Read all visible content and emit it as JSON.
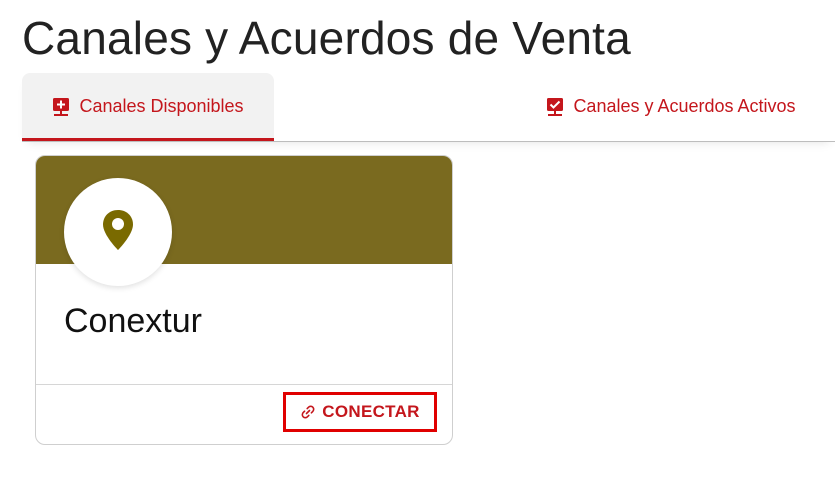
{
  "page": {
    "title": "Canales y Acuerdos de Venta"
  },
  "tabs": [
    {
      "label": "Canales Disponibles",
      "icon": "add-channel-icon",
      "selected": true
    },
    {
      "label": "Canales y Acuerdos Activos",
      "icon": "active-channel-check-icon",
      "selected": false
    }
  ],
  "card": {
    "name": "Conextur",
    "icon": "map-pin-icon",
    "banner_color": "#7a6a1f",
    "connect_label": "CONECTAR",
    "connect_icon": "link-icon"
  },
  "colors": {
    "accent": "#c4161c",
    "highlight_border": "#e00000"
  }
}
